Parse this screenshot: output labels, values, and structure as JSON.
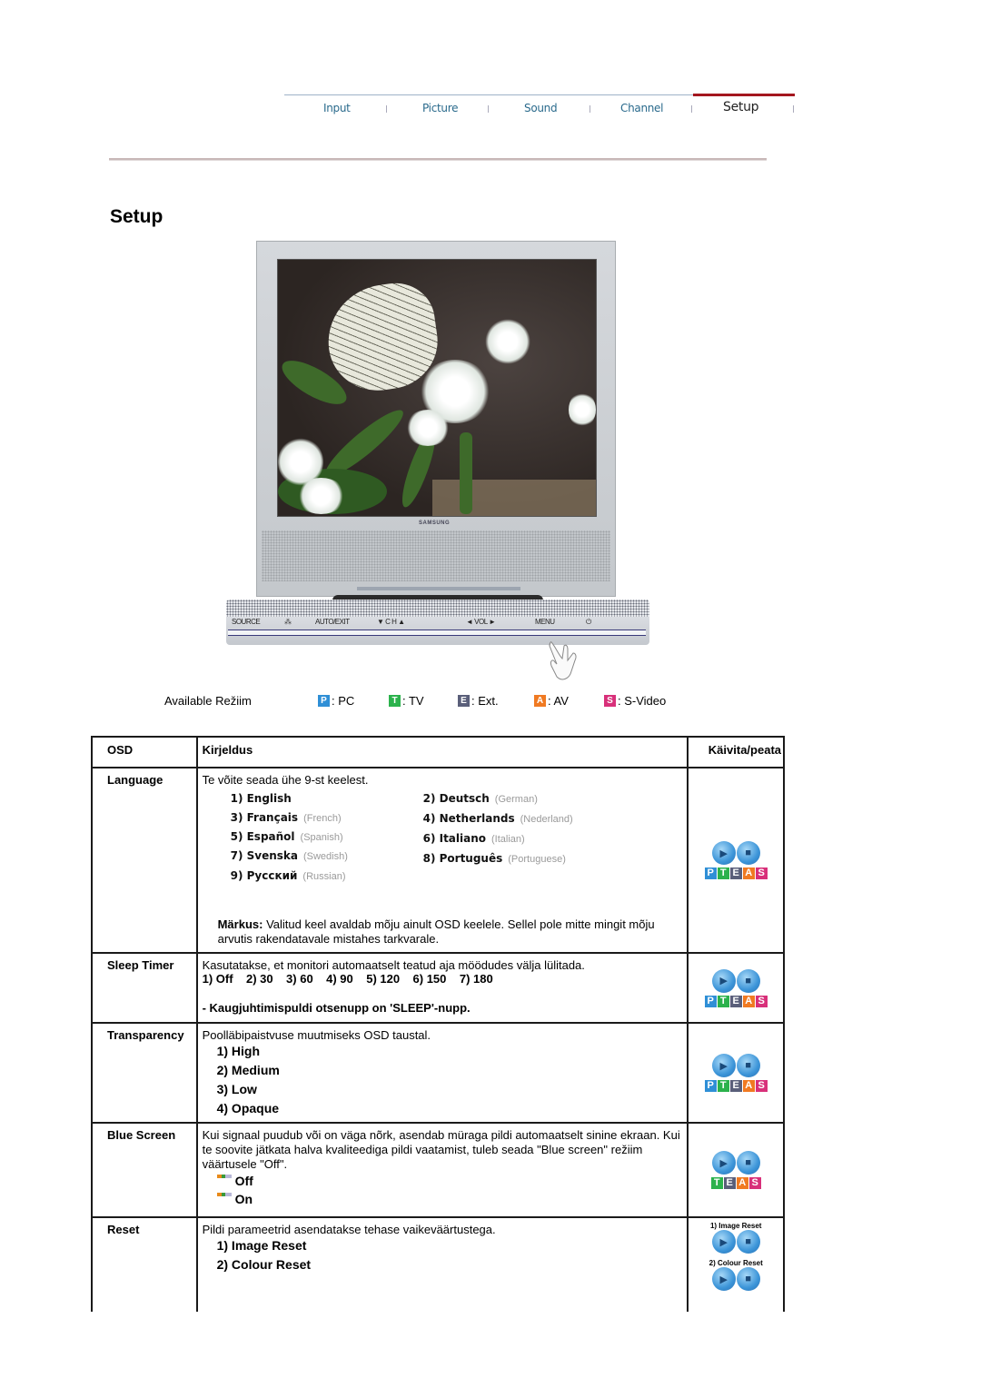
{
  "nav": {
    "tabs": [
      {
        "label": "Input",
        "active": false
      },
      {
        "label": "Picture",
        "active": false
      },
      {
        "label": "Sound",
        "active": false
      },
      {
        "label": "Channel",
        "active": false
      },
      {
        "label": "Setup",
        "active": true
      }
    ],
    "active_color": "#a4161e",
    "tab_color": "#2a6a8c"
  },
  "page": {
    "title": "Setup"
  },
  "monitor": {
    "brand": "SAMSUNG",
    "screen_image": "butterfly-on-white-flowers",
    "panel_buttons": [
      "SOURCE",
      "⁂",
      "AUTO/EXIT",
      "▼ C H ▲",
      "◄ VOL ►",
      "MENU",
      "⏻"
    ]
  },
  "modes": {
    "label": "Available Režiim",
    "items": [
      {
        "badge": "P",
        "label": ": PC",
        "color": "#2f8fd6"
      },
      {
        "badge": "T",
        "label": ": TV",
        "color": "#2bb24c"
      },
      {
        "badge": "E",
        "label": ": Ext.",
        "color": "#5a5f7a"
      },
      {
        "badge": "A",
        "label": ": AV",
        "color": "#f07a22"
      },
      {
        "badge": "S",
        "label": ": S-Video",
        "color": "#d8307a"
      }
    ]
  },
  "table": {
    "headers": {
      "osd": "OSD",
      "description": "Kirjeldus",
      "action": "Käivita/peata"
    },
    "language": {
      "name": "Language",
      "intro": "Te võite seada ühe 9-st keelest.",
      "languages": [
        {
          "n": "1) English",
          "tr": ""
        },
        {
          "n": "2) Deutsch",
          "tr": "(German)"
        },
        {
          "n": "3) Français",
          "tr": "(French)"
        },
        {
          "n": "4) Netherlands",
          "tr": "(Nederland)"
        },
        {
          "n": "5) Español",
          "tr": "(Spanish)"
        },
        {
          "n": "6) Italiano",
          "tr": "(Italian)"
        },
        {
          "n": "7) Svenska",
          "tr": "(Swedish)"
        },
        {
          "n": "8) Português",
          "tr": "(Portuguese)"
        },
        {
          "n": "9) Русский",
          "tr": "(Russian)"
        }
      ],
      "note_label": "Märkus:",
      "note_text": " Valitud keel avaldab mõju ainult OSD keelele. Sellel pole mitte mingit mõju arvutis rakendatavale mistahes tarkvarale.",
      "modes": "PTEAS"
    },
    "sleep": {
      "name": "Sleep Timer",
      "intro": "Kasutatakse, et monitori automaatselt teatud aja möödudes välja lülitada.",
      "options": "1) Off    2) 30    3) 60    4) 90    5) 120    6) 150    7) 180",
      "remote": "- Kaugjuhtimispuldi otsenupp on 'SLEEP'-nupp.",
      "modes": "PTEAS"
    },
    "transparency": {
      "name": "Transparency",
      "intro": "Poolläbipaistvuse muutmiseks OSD taustal.",
      "options": [
        "1) High",
        "2) Medium",
        "3) Low",
        "4) Opaque"
      ],
      "modes": "PTEAS"
    },
    "blue_screen": {
      "name": "Blue Screen",
      "intro": "Kui signaal puudub või on väga nõrk, asendab müraga pildi automaatselt sinine ekraan. Kui te soovite jätkata halva kvaliteediga pildi vaatamist, tuleb seada \"Blue screen\" režiim väärtusele \"Off\".",
      "options": [
        "Off",
        "On"
      ],
      "modes": "TEAS"
    },
    "reset": {
      "name": "Reset",
      "intro": "Pildi parameetrid asendatakse tehase vaikeväärtustega.",
      "options": [
        "1) Image Reset",
        "2) Colour Reset"
      ],
      "action_labels": [
        "1) Image Reset",
        "2) Colour Reset"
      ]
    }
  }
}
